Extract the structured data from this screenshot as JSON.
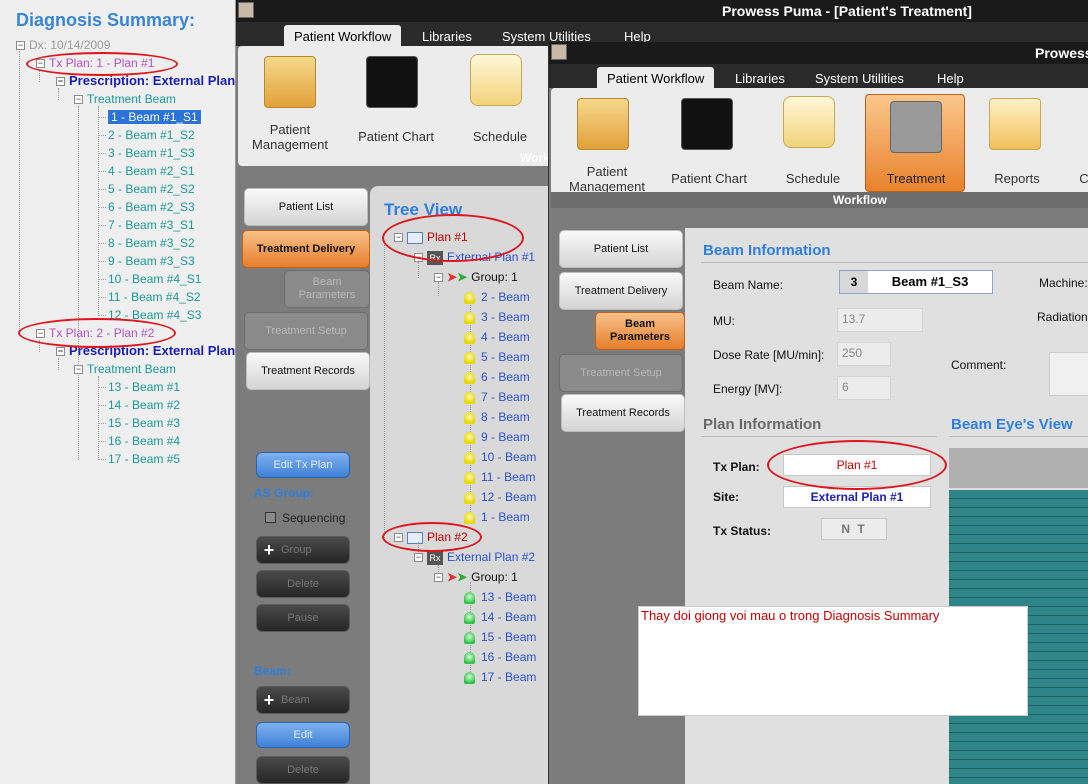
{
  "diagnosis": {
    "title": "Diagnosis Summary:",
    "dx": "Dx: 10/14/2009",
    "plans": [
      {
        "label": "Tx Plan: 1 - Plan #1",
        "prescription": "Prescription: External Plan",
        "treatment_beam": "Treatment Beam",
        "beams": [
          "1 - Beam #1_S1",
          "2 - Beam #1_S2",
          "3 - Beam #1_S3",
          "4 - Beam #2_S1",
          "5 - Beam #2_S2",
          "6 - Beam #2_S3",
          "7 - Beam #3_S1",
          "8 - Beam #3_S2",
          "9 - Beam #3_S3",
          "10 - Beam #4_S1",
          "11 - Beam #4_S2",
          "12 - Beam #4_S3"
        ]
      },
      {
        "label": "Tx Plan: 2 - Plan #2",
        "prescription": "Prescription: External Plan",
        "treatment_beam": "Treatment Beam",
        "beams": [
          "13 - Beam #1",
          "14 - Beam #2",
          "15 - Beam #3",
          "16 - Beam #4",
          "17 - Beam #5"
        ]
      }
    ]
  },
  "win1": {
    "title": "Prowess Puma - [Patient's Treatment]",
    "menus": [
      "Patient Workflow",
      "Libraries",
      "System Utilities",
      "Help"
    ],
    "ribbon": [
      "Patient Management",
      "Patient Chart",
      "Schedule"
    ],
    "ribbon_group": "Workf",
    "nav": [
      "Patient List",
      "Treatment Delivery",
      "Beam Parameters",
      "Treatment Setup",
      "Treatment Records"
    ],
    "edit_tx_plan": "Edit Tx Plan",
    "as_group": "AS Group:",
    "sequencing": "Sequencing",
    "group_btn": "Group",
    "delete_btn": "Delete",
    "pause_btn": "Pause",
    "beam_label": "Beam:",
    "beam_btn": "Beam",
    "edit_btn": "Edit",
    "delete_btn2": "Delete",
    "tree": {
      "title": "Tree View",
      "plan1": "Plan #1",
      "ext1": "External Plan #1",
      "group1": "Group:  1",
      "beams1": [
        "2 - Beam",
        "3 - Beam",
        "4 - Beam",
        "5 - Beam",
        "6 - Beam",
        "7 - Beam",
        "8 - Beam",
        "9 - Beam",
        "10 - Beam",
        "11 - Beam",
        "12 - Beam",
        "1 - Beam"
      ],
      "plan2": "Plan #2",
      "ext2": "External Plan #2",
      "group2": "Group:  1",
      "beams2": [
        "13 - Beam",
        "14 - Beam",
        "15 - Beam",
        "16 - Beam",
        "17 - Beam"
      ]
    }
  },
  "win2": {
    "title": "Prowess",
    "menus": [
      "Patient Workflow",
      "Libraries",
      "System Utilities",
      "Help"
    ],
    "ribbon": [
      "Patient Management",
      "Patient Chart",
      "Schedule",
      "Treatment",
      "Reports",
      "C"
    ],
    "ribbon_group": "Workflow",
    "nav": [
      "Patient List",
      "Treatment Delivery",
      "Beam Parameters",
      "Treatment Setup",
      "Treatment Records"
    ],
    "beam_info": {
      "title": "Beam Information",
      "beam_name_label": "Beam Name:",
      "beam_num": "3",
      "beam_name": "Beam #1_S3",
      "machine_label": "Machine:",
      "mu_label": "MU:",
      "mu": "13.7",
      "radiation_label": "Radiation",
      "dose_rate_label": "Dose Rate [MU/min]:",
      "dose_rate": "250",
      "comment_label": "Comment:",
      "energy_label": "Energy [MV]:",
      "energy": "6"
    },
    "plan_info": {
      "title": "Plan Information",
      "tx_plan_label": "Tx Plan:",
      "tx_plan": "Plan #1",
      "site_label": "Site:",
      "site": "External Plan #1",
      "tx_status_label": "Tx Status:",
      "tx_status": "N T"
    },
    "bev_title": "Beam Eye's View"
  },
  "note": "Thay doi giong voi mau o trong Diagnosis Summary"
}
